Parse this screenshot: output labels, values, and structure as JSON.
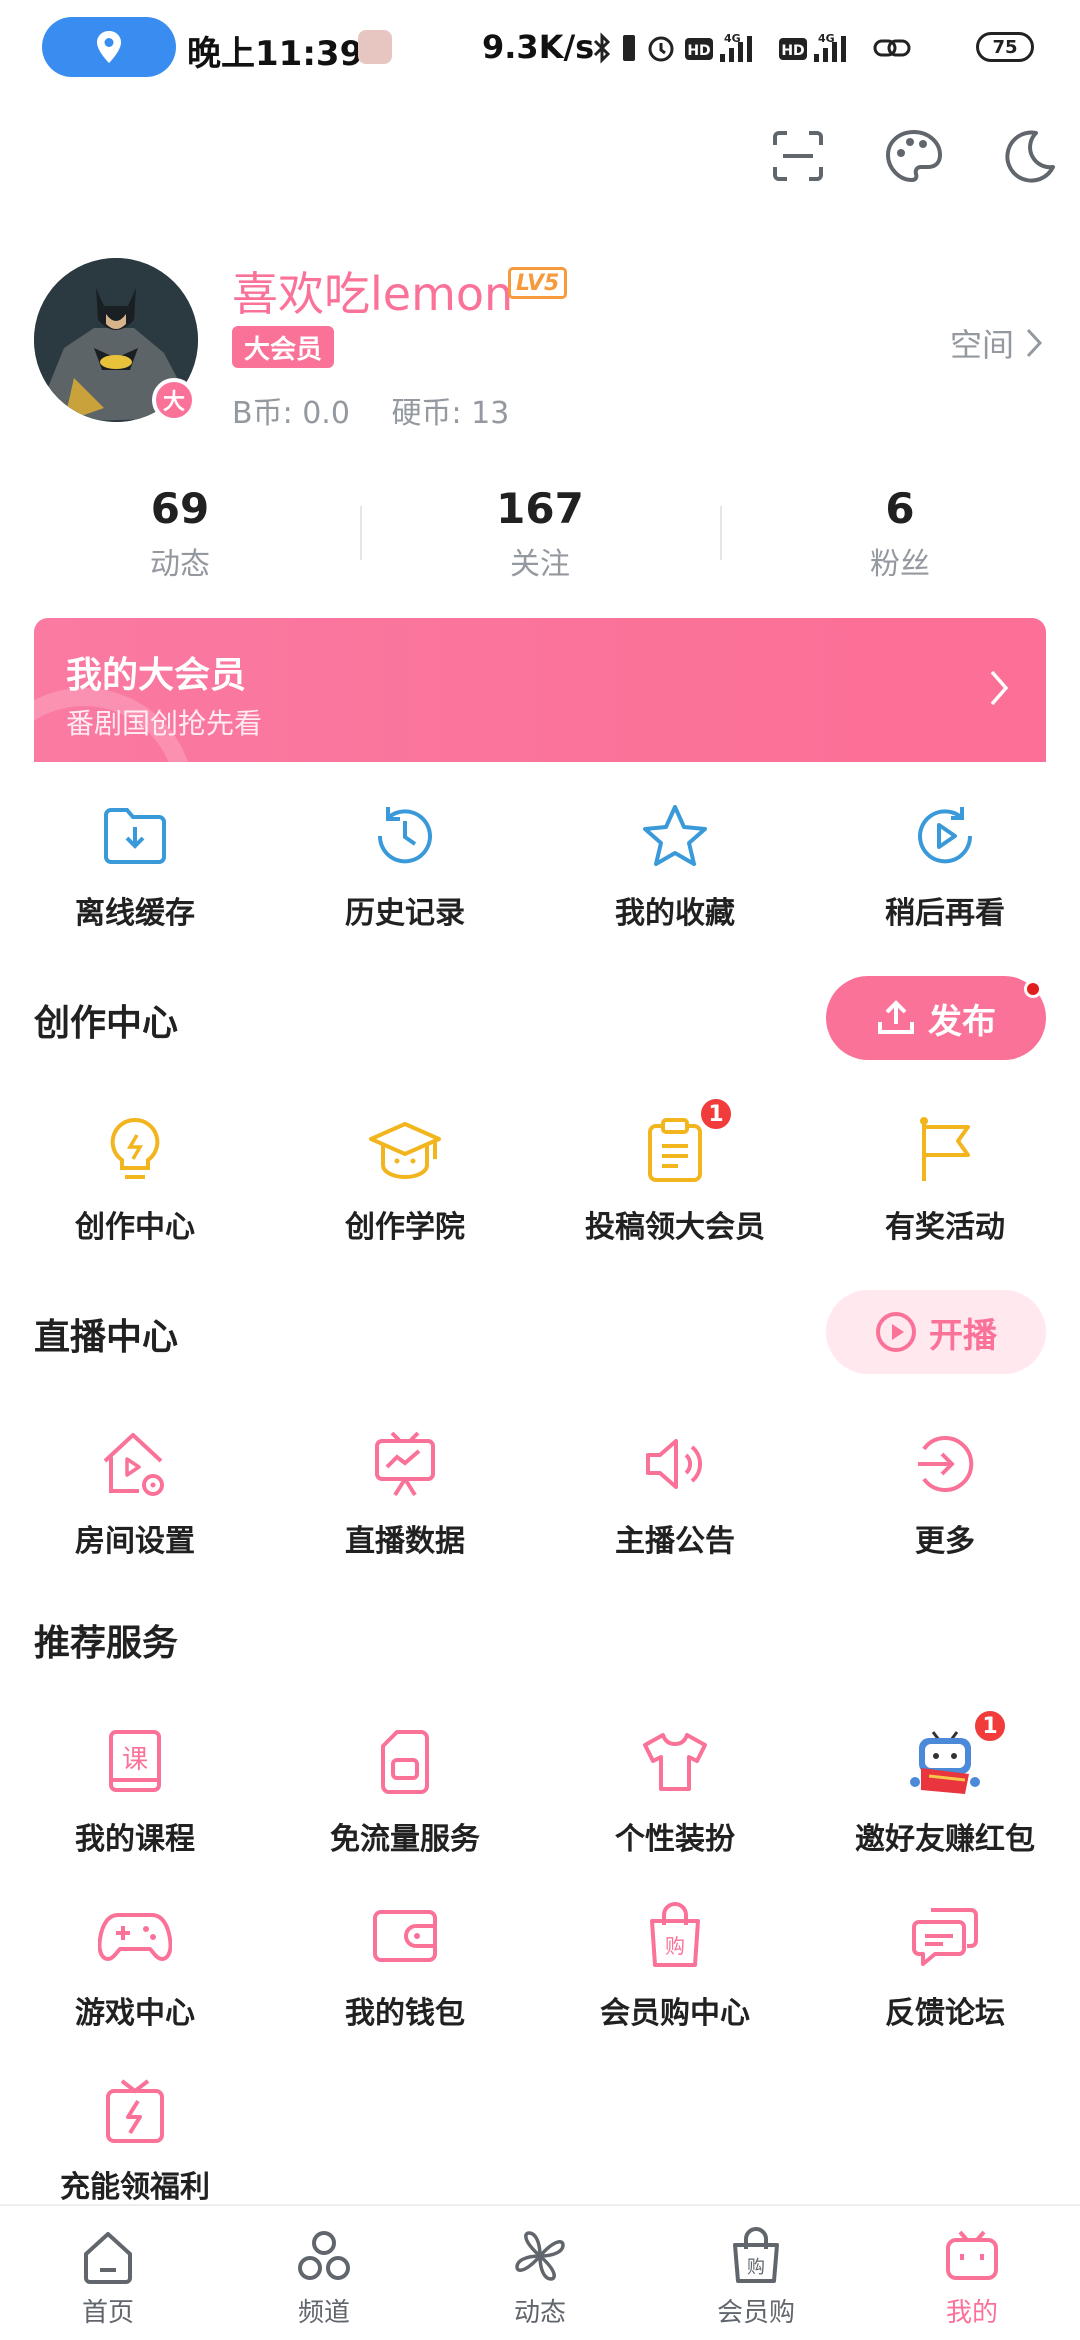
{
  "status_bar": {
    "time": "晚上11:39",
    "speed": "9.3K/s",
    "battery": "75"
  },
  "top_icons": [
    "scan-icon",
    "palette-icon",
    "moon-icon"
  ],
  "profile": {
    "username": "喜欢吃lemon",
    "level": "LV5",
    "vip_tag": "大会员",
    "avatar_badge": "大",
    "bcoin": "B币: 0.0",
    "coin": "硬币: 13",
    "space_label": "空间"
  },
  "stats": [
    {
      "value": "69",
      "label": "动态"
    },
    {
      "value": "167",
      "label": "关注"
    },
    {
      "value": "6",
      "label": "粉丝"
    }
  ],
  "vip_banner": {
    "title": "我的大会员",
    "subtitle": "番剧国创抢先看"
  },
  "quick_actions": [
    {
      "label": "离线缓存",
      "icon": "download-folder-icon"
    },
    {
      "label": "历史记录",
      "icon": "history-icon"
    },
    {
      "label": "我的收藏",
      "icon": "star-icon"
    },
    {
      "label": "稍后再看",
      "icon": "watch-later-icon"
    }
  ],
  "creation": {
    "title": "创作中心",
    "publish_label": "发布",
    "items": [
      {
        "label": "创作中心",
        "icon": "lightbulb-icon"
      },
      {
        "label": "创作学院",
        "icon": "graduation-cap-icon"
      },
      {
        "label": "投稿领大会员",
        "icon": "clipboard-icon",
        "badge": "1"
      },
      {
        "label": "有奖活动",
        "icon": "flag-icon"
      }
    ]
  },
  "live": {
    "title": "直播中心",
    "start_label": "开播",
    "items": [
      {
        "label": "房间设置",
        "icon": "room-settings-icon"
      },
      {
        "label": "直播数据",
        "icon": "live-data-icon"
      },
      {
        "label": "主播公告",
        "icon": "speaker-icon"
      },
      {
        "label": "更多",
        "icon": "more-arrow-icon"
      }
    ]
  },
  "services": {
    "title": "推荐服务",
    "row1": [
      {
        "label": "我的课程",
        "icon": "course-icon"
      },
      {
        "label": "免流量服务",
        "icon": "sim-card-icon"
      },
      {
        "label": "个性装扮",
        "icon": "tshirt-icon"
      },
      {
        "label": "邀好友赚红包",
        "icon": "invite-mascot-icon",
        "badge": "1"
      }
    ],
    "row2": [
      {
        "label": "游戏中心",
        "icon": "gamepad-icon"
      },
      {
        "label": "我的钱包",
        "icon": "wallet-icon"
      },
      {
        "label": "会员购中心",
        "icon": "shopping-bag-icon"
      },
      {
        "label": "反馈论坛",
        "icon": "feedback-icon"
      }
    ],
    "row3": [
      {
        "label": "充能领福利",
        "icon": "gift-charge-icon"
      }
    ]
  },
  "bottom_nav": [
    {
      "label": "首页",
      "icon": "home-icon"
    },
    {
      "label": "频道",
      "icon": "channels-icon"
    },
    {
      "label": "动态",
      "icon": "pinwheel-icon"
    },
    {
      "label": "会员购",
      "icon": "mall-bag-icon"
    },
    {
      "label": "我的",
      "icon": "tv-mascot-icon",
      "active": true
    }
  ],
  "colors": {
    "accent": "#fb7299",
    "blue_icon": "#3a9ad9",
    "yellow_icon": "#f2b51d",
    "muted_text": "#9499a0"
  }
}
